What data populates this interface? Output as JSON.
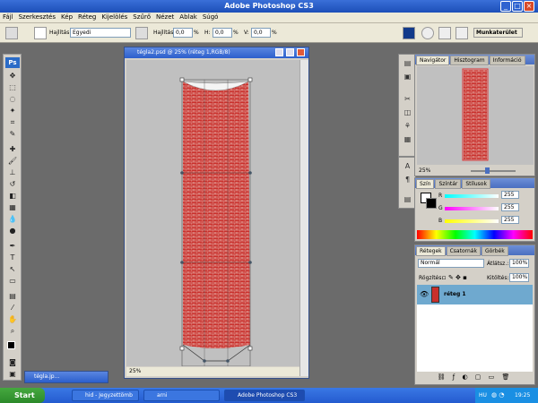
{
  "app": {
    "title": "Adobe Photoshop CS3"
  },
  "menu": [
    "Fájl",
    "Szerkesztés",
    "Kép",
    "Réteg",
    "Kijelölés",
    "Szűrő",
    "Nézet",
    "Ablak",
    "Súgó"
  ],
  "options": {
    "hajlitas_label": "Hajlítás:",
    "hajlitas_value": "Egyedi",
    "hajlitas2_label": "Hajlítás:",
    "hajlitas2_value": "0,0",
    "h_label": "H:",
    "h_value": "0,0",
    "v_label": "V:",
    "v_value": "0,0",
    "pct": "%",
    "workspace": "Munkaterület"
  },
  "document": {
    "title": "tégla2.psd @ 25% (réteg 1,RGB/8)",
    "zoom": "25%"
  },
  "minimized_doc": {
    "title": "tégla.jp..."
  },
  "navigator": {
    "tabs": [
      "Navigátor",
      "Hisztogram",
      "Információ"
    ],
    "zoom": "25%"
  },
  "color": {
    "tabs": [
      "Szín",
      "Színtár",
      "Stílusok"
    ],
    "r_label": "R",
    "r_value": "255",
    "g_label": "G",
    "g_value": "255",
    "b_label": "B",
    "b_value": "255"
  },
  "layers": {
    "tabs": [
      "Rétegek",
      "Csatornák",
      "Görbék"
    ],
    "blend_mode": "Normál",
    "opacity_label": "Átlátsz.:",
    "opacity_value": "100%",
    "lock_label": "Rögzítés:",
    "fill_label": "Kitöltés:",
    "fill_value": "100%",
    "layer_name": "réteg 1"
  },
  "taskbar": {
    "start": "Start",
    "tasks": [
      "hid - Jegyzettömb",
      "arni",
      "Adobe Photoshop CS3"
    ],
    "lang": "HU",
    "time": "19:25"
  },
  "colors": {
    "brick": "#c9302c",
    "mortar": "#e8d8d0",
    "accent": "#2b6cc7"
  }
}
